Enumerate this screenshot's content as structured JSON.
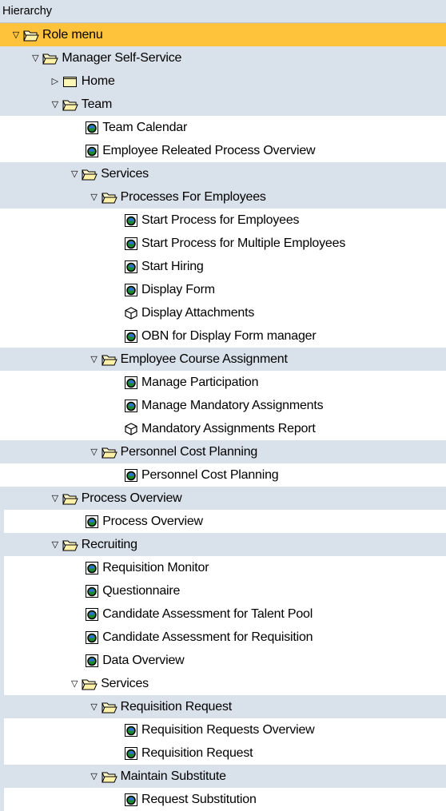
{
  "header": {
    "title": "Hierarchy"
  },
  "tree": [
    {
      "id": "role-menu",
      "label": "Role menu",
      "level": 0,
      "type": "folder",
      "state": "expanded",
      "band": true,
      "selected": true
    },
    {
      "id": "manager-self-service",
      "label": "Manager Self-Service",
      "level": 1,
      "type": "folder",
      "state": "expanded",
      "band": true
    },
    {
      "id": "home",
      "label": "Home",
      "level": 2,
      "type": "folder",
      "state": "collapsed",
      "band": true
    },
    {
      "id": "team",
      "label": "Team",
      "level": 2,
      "type": "folder",
      "state": "expanded",
      "band": true
    },
    {
      "id": "team-calendar",
      "label": "Team Calendar",
      "level": 3,
      "type": "app",
      "band": false
    },
    {
      "id": "employee-releated-process-overview",
      "label": "Employee Releated Process Overview",
      "level": 3,
      "type": "app",
      "band": false
    },
    {
      "id": "services-1",
      "label": "Services",
      "level": 3,
      "type": "folder",
      "state": "expanded",
      "band": true
    },
    {
      "id": "processes-for-employees",
      "label": "Processes For Employees",
      "level": 4,
      "type": "folder",
      "state": "expanded",
      "band": true
    },
    {
      "id": "start-process-for-employees",
      "label": "Start Process for Employees",
      "level": 5,
      "type": "app",
      "band": false
    },
    {
      "id": "start-process-multiple",
      "label": "Start Process for Multiple Employees",
      "level": 5,
      "type": "app",
      "band": false
    },
    {
      "id": "start-hiring",
      "label": "Start Hiring",
      "level": 5,
      "type": "app",
      "band": false
    },
    {
      "id": "display-form",
      "label": "Display Form",
      "level": 5,
      "type": "app",
      "band": false
    },
    {
      "id": "display-attachments",
      "label": "Display Attachments",
      "level": 5,
      "type": "cube",
      "band": false
    },
    {
      "id": "obn-display-form-manager",
      "label": "OBN for  Display Form manager",
      "level": 5,
      "type": "app",
      "band": false
    },
    {
      "id": "employee-course-assignment",
      "label": "Employee Course Assignment",
      "level": 4,
      "type": "folder",
      "state": "expanded",
      "band": true
    },
    {
      "id": "manage-participation",
      "label": "Manage Participation",
      "level": 5,
      "type": "app",
      "band": false
    },
    {
      "id": "manage-mandatory-assignments",
      "label": "Manage Mandatory Assignments",
      "level": 5,
      "type": "app",
      "band": false
    },
    {
      "id": "mandatory-assignments-report",
      "label": "Mandatory Assignments Report",
      "level": 5,
      "type": "cube",
      "band": false
    },
    {
      "id": "personnel-cost-planning-folder",
      "label": "Personnel Cost Planning",
      "level": 4,
      "type": "folder",
      "state": "expanded",
      "band": true
    },
    {
      "id": "personnel-cost-planning-app",
      "label": "Personnel Cost Planning",
      "level": 5,
      "type": "app",
      "band": false
    },
    {
      "id": "process-overview-folder",
      "label": "Process Overview",
      "level": 2,
      "type": "folder",
      "state": "expanded",
      "band": true
    },
    {
      "id": "process-overview-app",
      "label": "Process Overview",
      "level": 3,
      "type": "app",
      "band": false,
      "strip": true
    },
    {
      "id": "recruiting",
      "label": "Recruiting",
      "level": 2,
      "type": "folder",
      "state": "expanded",
      "band": true
    },
    {
      "id": "requisition-monitor",
      "label": "Requisition Monitor",
      "level": 3,
      "type": "app",
      "band": false,
      "strip": true
    },
    {
      "id": "questionnaire",
      "label": "Questionnaire",
      "level": 3,
      "type": "app",
      "band": false,
      "strip": true
    },
    {
      "id": "candidate-assessment-talent-pool",
      "label": "Candidate Assessment for Talent Pool",
      "level": 3,
      "type": "app",
      "band": false,
      "strip": true
    },
    {
      "id": "candidate-assessment-requisition",
      "label": "Candidate Assessment for Requisition",
      "level": 3,
      "type": "app",
      "band": false,
      "strip": true
    },
    {
      "id": "data-overview",
      "label": "Data Overview",
      "level": 3,
      "type": "app",
      "band": false,
      "strip": true
    },
    {
      "id": "services-2",
      "label": "Services",
      "level": 3,
      "type": "folder",
      "state": "expanded",
      "band": false,
      "strip": true
    },
    {
      "id": "requisition-request-folder",
      "label": "Requisition Request",
      "level": 4,
      "type": "folder",
      "state": "expanded",
      "band": true
    },
    {
      "id": "requisition-requests-overview",
      "label": "Requisition Requests Overview",
      "level": 5,
      "type": "app",
      "band": false,
      "strip": true
    },
    {
      "id": "requisition-request-app",
      "label": "Requisition Request",
      "level": 5,
      "type": "app",
      "band": false,
      "strip": true
    },
    {
      "id": "maintain-substitute",
      "label": "Maintain Substitute",
      "level": 4,
      "type": "folder",
      "state": "expanded",
      "band": true
    },
    {
      "id": "request-substitution",
      "label": "Request Substitution",
      "level": 5,
      "type": "app",
      "band": false,
      "strip": true
    }
  ]
}
